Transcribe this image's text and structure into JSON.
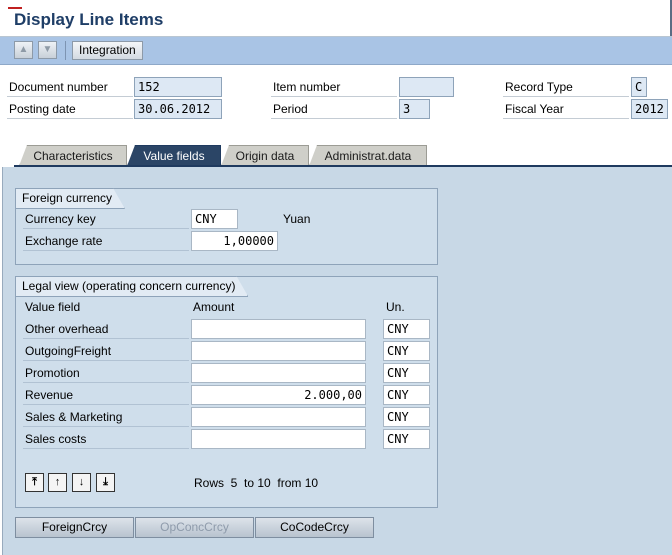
{
  "window": {
    "title": "Display Line Items"
  },
  "toolbar": {
    "integration_label": "Integration"
  },
  "header": {
    "document_number": {
      "label": "Document number",
      "value": "152"
    },
    "posting_date": {
      "label": "Posting date",
      "value": "30.06.2012"
    },
    "item_number": {
      "label": "Item number",
      "value": ""
    },
    "period": {
      "label": "Period",
      "value": "3"
    },
    "record_type": {
      "label": "Record Type",
      "value": "C"
    },
    "fiscal_year": {
      "label": "Fiscal Year",
      "value": "2012"
    }
  },
  "tabs": [
    {
      "label": "Characteristics",
      "active": false
    },
    {
      "label": "Value fields",
      "active": true
    },
    {
      "label": "Origin data",
      "active": false
    },
    {
      "label": "Administrat.data",
      "active": false
    }
  ],
  "foreign_currency": {
    "title": "Foreign currency",
    "currency_key": {
      "label": "Currency key",
      "value": "CNY",
      "description": "Yuan"
    },
    "exchange_rate": {
      "label": "Exchange rate",
      "value": "1,00000"
    }
  },
  "legal_view": {
    "title": "Legal view (operating concern currency)",
    "columns": {
      "value_field": "Value field",
      "amount": "Amount",
      "unit": "Un."
    },
    "rows": [
      {
        "field": "Other overhead",
        "amount": "",
        "unit": "CNY"
      },
      {
        "field": "OutgoingFreight",
        "amount": "",
        "unit": "CNY"
      },
      {
        "field": "Promotion",
        "amount": "",
        "unit": "CNY"
      },
      {
        "field": "Revenue",
        "amount": "2.000,00",
        "unit": "CNY"
      },
      {
        "field": "Sales & Marketing",
        "amount": "",
        "unit": "CNY"
      },
      {
        "field": "Sales costs",
        "amount": "",
        "unit": "CNY"
      }
    ],
    "rows_info": "Rows  5  to 10  from 10"
  },
  "bottom_buttons": [
    {
      "label": "ForeignCrcy",
      "enabled": true
    },
    {
      "label": "OpConcCrcy",
      "enabled": false
    },
    {
      "label": "CoCodeCrcy",
      "enabled": true
    }
  ],
  "icons": {
    "up": "arrow-up-icon",
    "down": "arrow-down-icon",
    "first_page": "first-page-icon",
    "prev_page": "previous-page-icon",
    "next_page": "next-page-icon",
    "last_page": "last-page-icon"
  },
  "colors": {
    "toolbar": "#a9c4e5",
    "active_tab": "#2b4566",
    "panel": "#c8d8e6",
    "title": "#1f3e67"
  }
}
